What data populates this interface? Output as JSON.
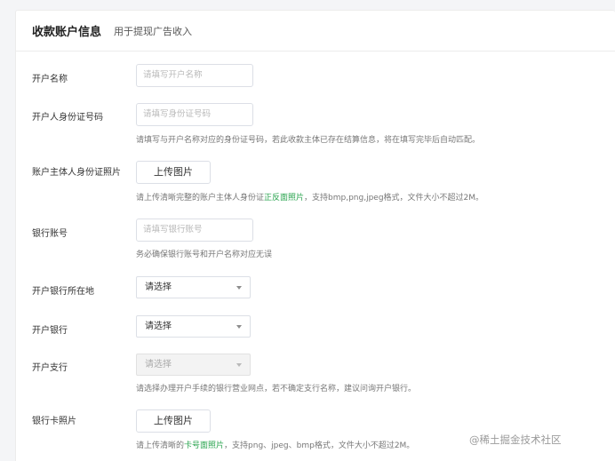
{
  "header": {
    "title": "收款账户信息",
    "subtitle": "用于提现广告收入"
  },
  "form": {
    "account_name": {
      "label": "开户名称",
      "placeholder": "请填写开户名称"
    },
    "id_number": {
      "label": "开户人身份证号码",
      "placeholder": "请填写身份证号码",
      "hint": "请填写与开户名称对应的身份证号码，若此收款主体已存在结算信息，将在填写完毕后自动匹配。"
    },
    "id_photo": {
      "label": "账户主体人身份证照片",
      "button": "上传图片",
      "hint_before": "请上传清晰完整的账户主体人身份证",
      "hint_highlight": "正反面照片",
      "hint_after": "，支持bmp,png,jpeg格式，文件大小不超过2M。"
    },
    "bank_account": {
      "label": "银行账号",
      "placeholder": "请填写银行账号",
      "hint": "务必确保银行账号和开户名称对应无误"
    },
    "bank_location": {
      "label": "开户银行所在地",
      "value": "请选择"
    },
    "bank": {
      "label": "开户银行",
      "value": "请选择"
    },
    "branch": {
      "label": "开户支行",
      "value": "请选择",
      "hint": "请选择办理开户手续的银行营业网点，若不确定支行名称，建议问询开户银行。"
    },
    "card_photo": {
      "label": "银行卡照片",
      "button": "上传图片",
      "hint_before": "请上传清晰的",
      "hint_highlight": "卡号面照片",
      "hint_after": "，支持png、jpeg、bmp格式，文件大小不超过2M。"
    }
  },
  "watermark": "@稀土掘金技术社区",
  "icons": {
    "select_arrow": "caret-down-icon"
  },
  "colors": {
    "highlight": "#2aa44f",
    "background": "#f4f5f7",
    "card": "#ffffff"
  }
}
